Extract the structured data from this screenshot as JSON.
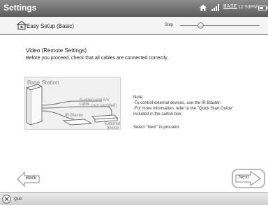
{
  "titlebar": {
    "title": "Settings",
    "base_label": "BASE",
    "clock": "12:53PM"
  },
  "header": {
    "title": "Easy Setup (Basic)",
    "step_label": "Step",
    "step_progress": 0.26
  },
  "main": {
    "heading": "Video (Remote Settings)",
    "instruction": "Before you proceed, check that all cables are connected correctly.",
    "diagram": {
      "base_station": "Base Station",
      "svideo_cable": "S-video and A/V cable",
      "not_supplied": "(not supplied)",
      "ir_blaster": "IR Blaster",
      "external": "External",
      "device": "device"
    },
    "note_lines": [
      "Note:",
      "-To control external devices, use the IR Blaster.",
      "-For more information, refer to the \"Quick Start Guide\"",
      " included in the carton box."
    ],
    "proceed": "Select \"Next\" to proceed."
  },
  "nav": {
    "back_label": "Back",
    "next_label": "Next"
  },
  "bottombar": {
    "quit_label": "Quit"
  },
  "icons": {
    "home": "home-icon",
    "signal": "signal-icon",
    "battery": "battery-icon",
    "easy_setup": "easy-setup-icon",
    "quit": "quit-icon"
  },
  "colors": {
    "titlebar": "#6e6e6e",
    "header_bg": "#f4f4f4",
    "diagram_bg": "#f0f0f0",
    "bottombar": "#dcdcdc"
  }
}
